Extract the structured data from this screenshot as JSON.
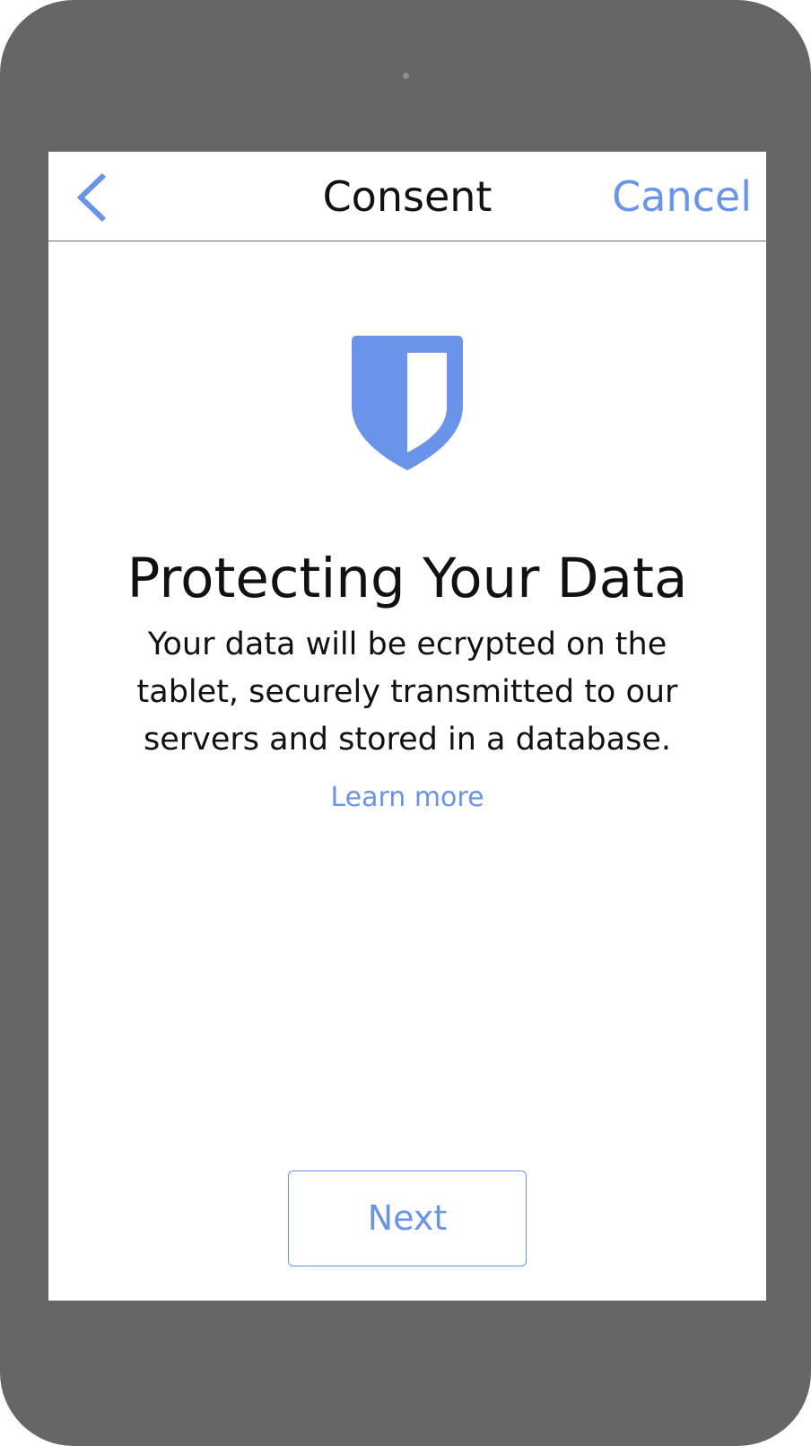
{
  "nav": {
    "back_icon": "chevron-left-icon",
    "title": "Consent",
    "cancel_label": "Cancel"
  },
  "content": {
    "icon": "shield-icon",
    "headline": "Protecting Your Data",
    "body": "Your data will be ecrypted on the tablet, securely transmitted to our servers and stored in a database.",
    "learn_more_label": "Learn more"
  },
  "footer": {
    "next_label": "Next"
  },
  "colors": {
    "accent": "#6a93ea",
    "device_frame": "#666666",
    "text": "#111111",
    "background": "#ffffff"
  }
}
